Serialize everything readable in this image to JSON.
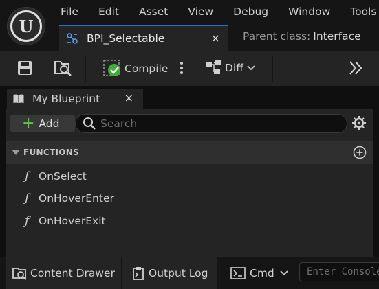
{
  "menu": [
    "File",
    "Edit",
    "Asset",
    "View",
    "Debug",
    "Window",
    "Tools"
  ],
  "document_tab": {
    "label": "BPI_Selectable",
    "close": "×"
  },
  "parent_class": {
    "label": "Parent class:",
    "value": "Interface"
  },
  "toolbar": {
    "compile_label": "Compile",
    "diff_label": "Diff"
  },
  "my_blueprint": {
    "tab_label": "My Blueprint",
    "close": "×",
    "add_label": "Add",
    "search_placeholder": "Search",
    "section_label": "FUNCTIONS",
    "function_glyph": "ƒ",
    "functions": [
      "OnSelect",
      "OnHoverEnter",
      "OnHoverExit"
    ]
  },
  "statusbar": {
    "content_drawer_label": "Content Drawer",
    "output_log_label": "Output Log",
    "cmd_label": "Cmd",
    "console_placeholder": "Enter Console Command"
  },
  "colors": {
    "accent_tab": "#2d6fd6",
    "add_plus": "#5fc93a",
    "compile_ok": "#3fae3b"
  }
}
